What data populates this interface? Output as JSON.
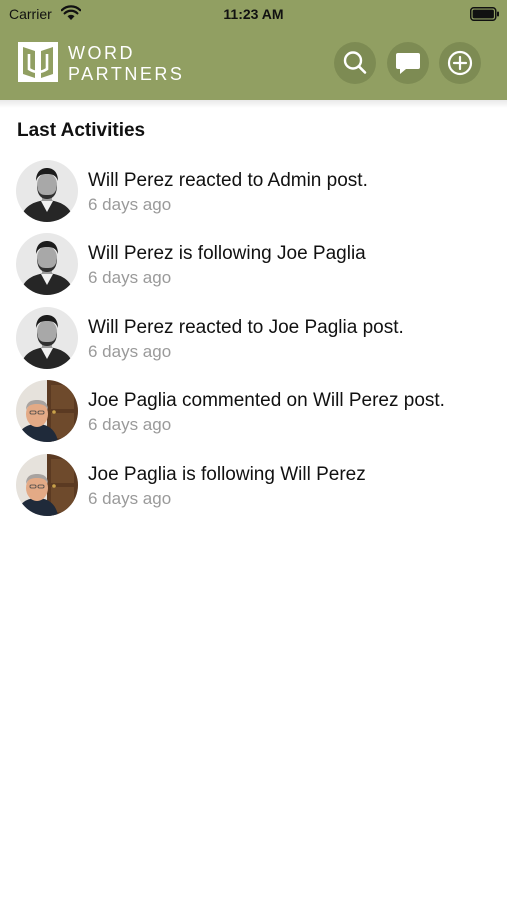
{
  "status_bar": {
    "carrier": "Carrier",
    "time": "11:23 AM",
    "wifi_icon": "wifi-icon",
    "battery_icon": "battery-icon"
  },
  "header": {
    "logo_line1": "WORD",
    "logo_line2": "PARTNERS",
    "background_color": "#919f62",
    "buttons": [
      {
        "icon": "search-icon"
      },
      {
        "icon": "chat-bubble-icon"
      },
      {
        "icon": "plus-circle-icon"
      }
    ]
  },
  "main": {
    "section_title": "Last Activities",
    "activities": [
      {
        "text": "Will Perez reacted to Admin post.",
        "time": "6 days ago",
        "avatar": "will-perez-avatar"
      },
      {
        "text": "Will Perez is following Joe Paglia",
        "time": "6 days ago",
        "avatar": "will-perez-avatar"
      },
      {
        "text": "Will Perez reacted to Joe Paglia post.",
        "time": "6 days ago",
        "avatar": "will-perez-avatar"
      },
      {
        "text": "Joe Paglia commented on Will Perez post.",
        "time": "6 days ago",
        "avatar": "joe-paglia-avatar"
      },
      {
        "text": "Joe Paglia is following Will Perez",
        "time": "6 days ago",
        "avatar": "joe-paglia-avatar"
      }
    ]
  }
}
